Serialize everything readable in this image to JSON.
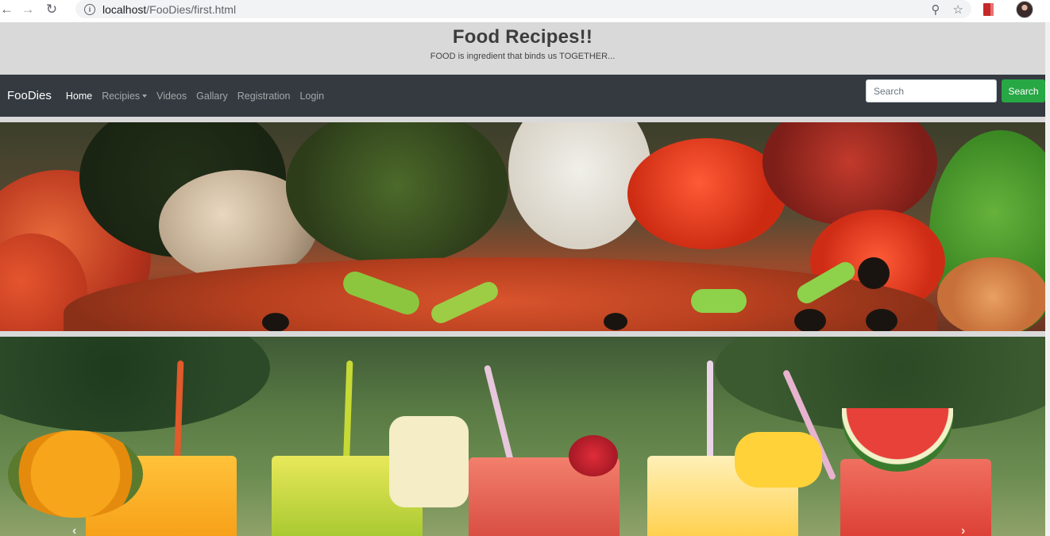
{
  "browser": {
    "url_host": "localhost",
    "url_path": "/FooDies/first.html"
  },
  "header": {
    "title": "Food Recipes!!",
    "subtitle": "FOOD is ingredient that binds us TOGETHER..."
  },
  "navbar": {
    "brand": "FooDies",
    "links": [
      {
        "label": "Home",
        "active": true
      },
      {
        "label": "Recipies",
        "dropdown": true
      },
      {
        "label": "Videos"
      },
      {
        "label": "Gallary"
      },
      {
        "label": "Registration"
      },
      {
        "label": "Login"
      }
    ],
    "search": {
      "placeholder": "Search",
      "button_label": "Search"
    }
  },
  "carousel": {
    "prev_label": "‹",
    "next_label": "›"
  },
  "colors": {
    "navbar_bg": "#343a40",
    "search_button": "#28a745",
    "header_bg": "#d9d9d9"
  }
}
